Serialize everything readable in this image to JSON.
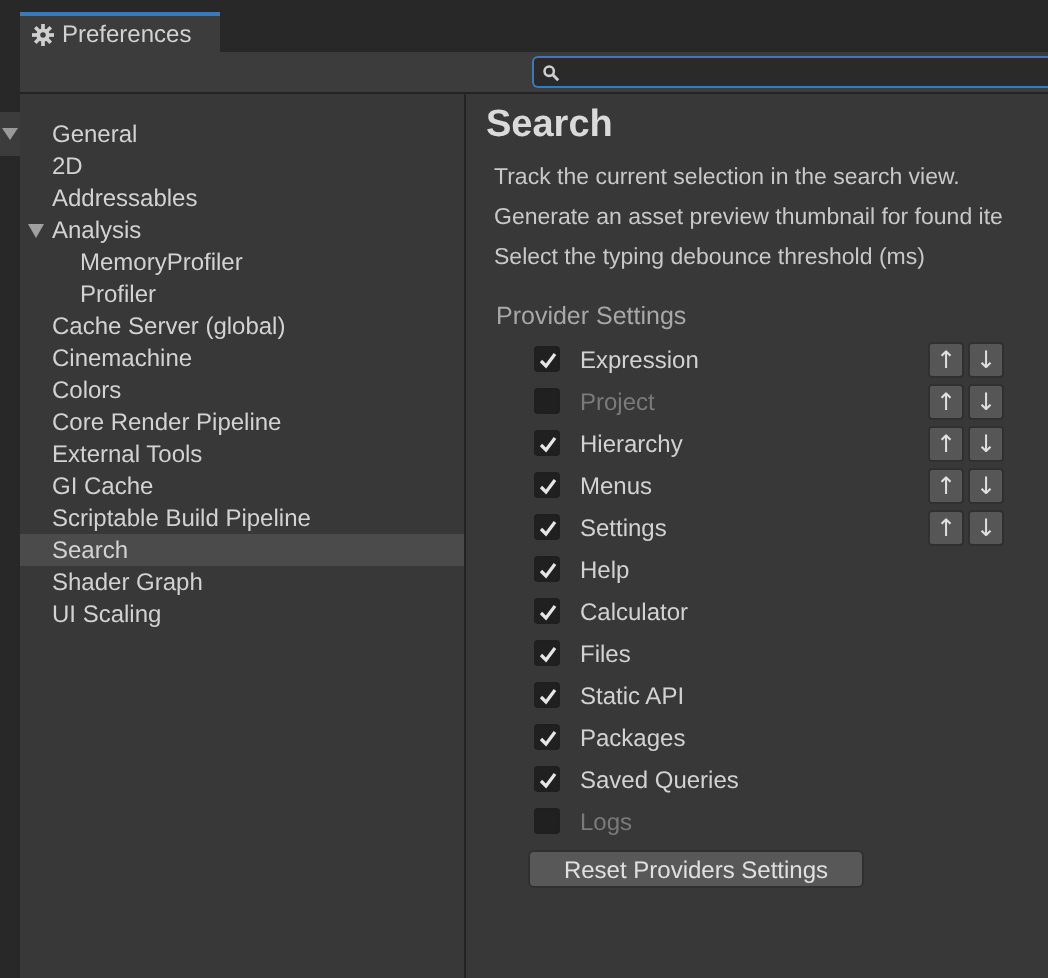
{
  "window": {
    "title": "Preferences"
  },
  "search_field": {
    "focused": true
  },
  "sidebar": {
    "items": [
      {
        "label": "General",
        "selected": false
      },
      {
        "label": "2D",
        "selected": false
      },
      {
        "label": "Addressables",
        "selected": false
      },
      {
        "label": "Analysis",
        "selected": false,
        "expanded": true,
        "children": [
          {
            "label": "MemoryProfiler",
            "selected": false
          },
          {
            "label": "Profiler",
            "selected": false
          }
        ]
      },
      {
        "label": "Cache Server (global)",
        "selected": false
      },
      {
        "label": "Cinemachine",
        "selected": false
      },
      {
        "label": "Colors",
        "selected": false
      },
      {
        "label": "Core Render Pipeline",
        "selected": false
      },
      {
        "label": "External Tools",
        "selected": false
      },
      {
        "label": "GI Cache",
        "selected": false
      },
      {
        "label": "Scriptable Build Pipeline",
        "selected": false
      },
      {
        "label": "Search",
        "selected": true
      },
      {
        "label": "Shader Graph",
        "selected": false
      },
      {
        "label": "UI Scaling",
        "selected": false
      }
    ]
  },
  "page": {
    "title": "Search",
    "options": [
      "Track the current selection in the search view.",
      "Generate an asset preview thumbnail for found ite",
      "Select the typing debounce threshold (ms)"
    ],
    "provider_settings": {
      "heading": "Provider Settings",
      "providers": [
        {
          "label": "Expression",
          "checked": true,
          "up": "↑",
          "down": "↓"
        },
        {
          "label": "Project",
          "checked": false,
          "up": "↑",
          "down": "↓"
        },
        {
          "label": "Hierarchy",
          "checked": true,
          "up": "↑",
          "down": "↓"
        },
        {
          "label": "Menus",
          "checked": true,
          "up": "↑",
          "down": "↓"
        },
        {
          "label": "Settings",
          "checked": true,
          "up": "↑",
          "down": "↓"
        },
        {
          "label": "Help",
          "checked": true
        },
        {
          "label": "Calculator",
          "checked": true
        },
        {
          "label": "Files",
          "checked": true
        },
        {
          "label": "Static API",
          "checked": true
        },
        {
          "label": "Packages",
          "checked": true
        },
        {
          "label": "Saved Queries",
          "checked": true
        },
        {
          "label": "Logs",
          "checked": false
        }
      ]
    },
    "reset_button": "Reset Providers Settings"
  }
}
